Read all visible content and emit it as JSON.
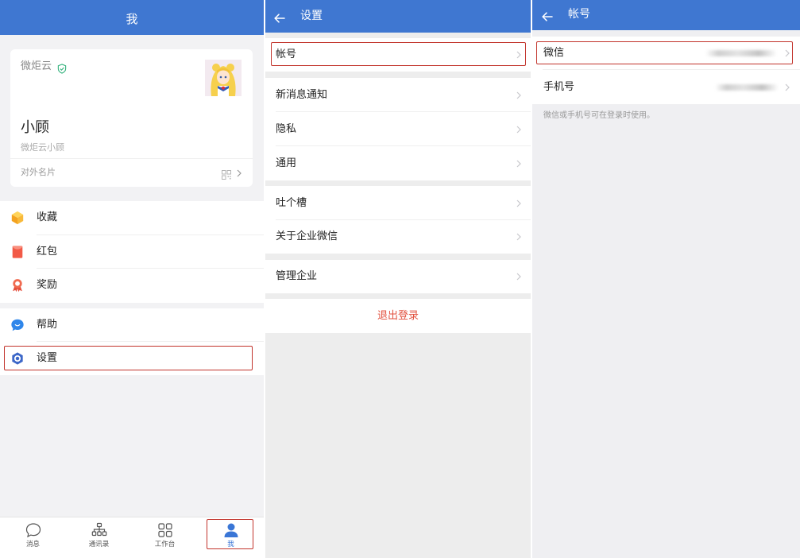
{
  "colors": {
    "header_blue": "#3f77d1",
    "accent_blue": "#3a76d6",
    "logout_red": "#e2513f",
    "highlight_red": "#c2342c",
    "verified_green": "#36b37e"
  },
  "me_screen": {
    "header_title": "我",
    "profile": {
      "company": "微炬云",
      "verified_icon": "shield-check-icon",
      "name": "小顾",
      "full_name": "微炬云小顾",
      "card_label": "对外名片",
      "card_icon": "qr-code-icon"
    },
    "menu": [
      {
        "label": "收藏",
        "icon": "favorites-cube-icon"
      },
      {
        "label": "红包",
        "icon": "red-envelope-icon"
      },
      {
        "label": "奖励",
        "icon": "award-medal-icon"
      },
      {
        "label": "帮助",
        "icon": "help-chat-icon"
      },
      {
        "label": "设置",
        "icon": "settings-hexagon-icon",
        "highlighted": true
      }
    ],
    "tabs": [
      {
        "label": "消息",
        "icon": "chat-bubble-icon",
        "active": false
      },
      {
        "label": "通讯录",
        "icon": "org-chart-icon",
        "active": false
      },
      {
        "label": "工作台",
        "icon": "grid-icon",
        "active": false
      },
      {
        "label": "我",
        "icon": "person-icon",
        "active": true,
        "highlighted": true
      }
    ]
  },
  "settings_screen": {
    "header_title": "设置",
    "rows": [
      {
        "label": "帐号",
        "highlighted": true
      },
      {
        "label": "新消息通知"
      },
      {
        "label": "隐私"
      },
      {
        "label": "通用"
      },
      {
        "label": "吐个槽"
      },
      {
        "label": "关于企业微信"
      },
      {
        "label": "管理企业"
      }
    ],
    "logout_label": "退出登录"
  },
  "account_screen": {
    "header_title": "帐号",
    "rows": [
      {
        "label": "微信",
        "value_blurred": true,
        "highlighted": true
      },
      {
        "label": "手机号",
        "value_blurred": true
      }
    ],
    "note": "微信或手机号可在登录时使用。"
  }
}
